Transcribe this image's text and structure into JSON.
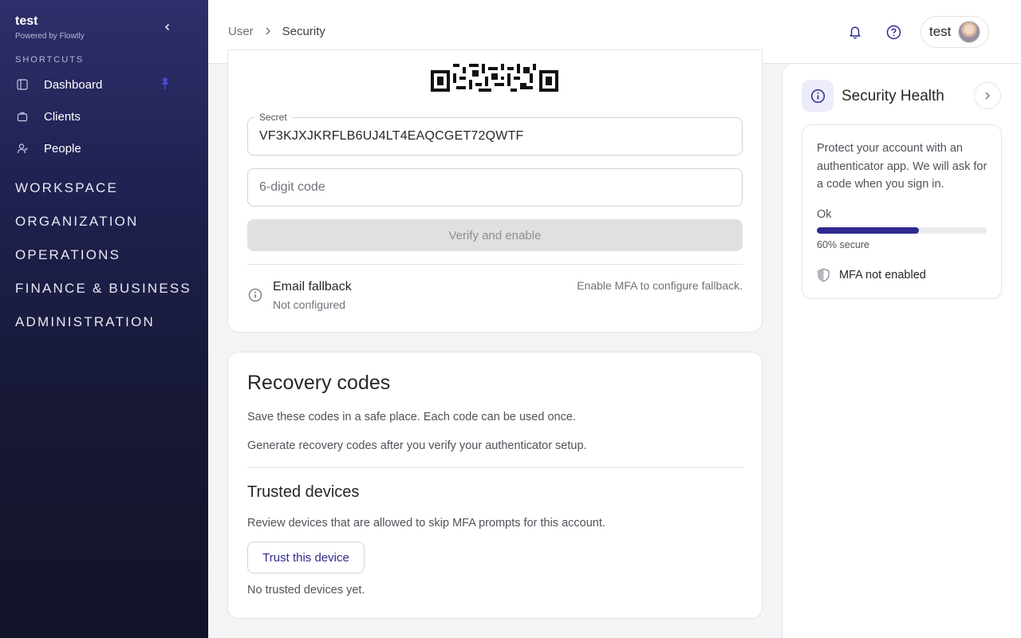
{
  "sidebar": {
    "brand": {
      "title": "test",
      "subtitle": "Powered by Flowtly"
    },
    "shortcuts_label": "SHORTCUTS",
    "shortcuts": [
      {
        "label": "Dashboard",
        "icon": "sidebar-panel-icon",
        "pinned": true
      },
      {
        "label": "Clients",
        "icon": "briefcase-icon"
      },
      {
        "label": "People",
        "icon": "person-icon"
      }
    ],
    "sections": [
      "WORKSPACE",
      "ORGANIZATION",
      "OPERATIONS",
      "FINANCE & BUSINESS",
      "ADMINISTRATION"
    ]
  },
  "header": {
    "breadcrumb": [
      "User",
      "Security"
    ],
    "user_name": "test"
  },
  "mfa": {
    "secret_label": "Secret",
    "secret_value": "VF3KJXJKRFLB6UJ4LT4EAQCGET72QWTF",
    "code_placeholder": "6-digit code",
    "verify_label": "Verify and enable",
    "fallback_title": "Email fallback",
    "fallback_status": "Not configured",
    "fallback_note": "Enable MFA to configure fallback."
  },
  "recovery": {
    "title": "Recovery codes",
    "desc": "Save these codes in a safe place. Each code can be used once.",
    "hint": "Generate recovery codes after you verify your authenticator setup."
  },
  "trusted": {
    "title": "Trusted devices",
    "desc": "Review devices that are allowed to skip MFA prompts for this account.",
    "button": "Trust this device",
    "empty": "No trusted devices yet."
  },
  "health": {
    "title": "Security Health",
    "desc": "Protect your account with an authenticator app. We will ask for a code when you sign in.",
    "status": "Ok",
    "score": 0.6,
    "score_label": "60% secure",
    "mfa_status": "MFA not enabled",
    "accent": "#2e2a8f"
  }
}
